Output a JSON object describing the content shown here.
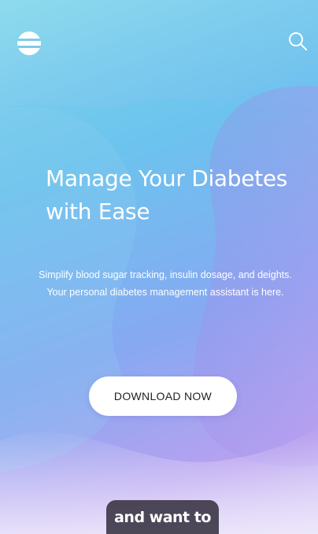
{
  "header": {
    "menu_icon": "menu-icon",
    "search_icon": "search-icon"
  },
  "hero": {
    "title_line1": "Manage Your Diabetes",
    "title_line2": "with Ease",
    "subtitle_line1": "Simplify blood sugar tracking, insulin dosage, and deights.",
    "subtitle_line2": "Your personal diabetes management assistant is here.",
    "cta_label": "DOWNLOAD NOW"
  },
  "overlay": {
    "caption": "and want to"
  },
  "colors": {
    "gradient_top": "#7fd6ea",
    "gradient_mid": "#86a9f2",
    "gradient_bottom": "#d9ccf5",
    "text": "#ffffff",
    "button_bg": "#ffffff",
    "button_text": "#222222",
    "caption_bg": "#37323f"
  }
}
